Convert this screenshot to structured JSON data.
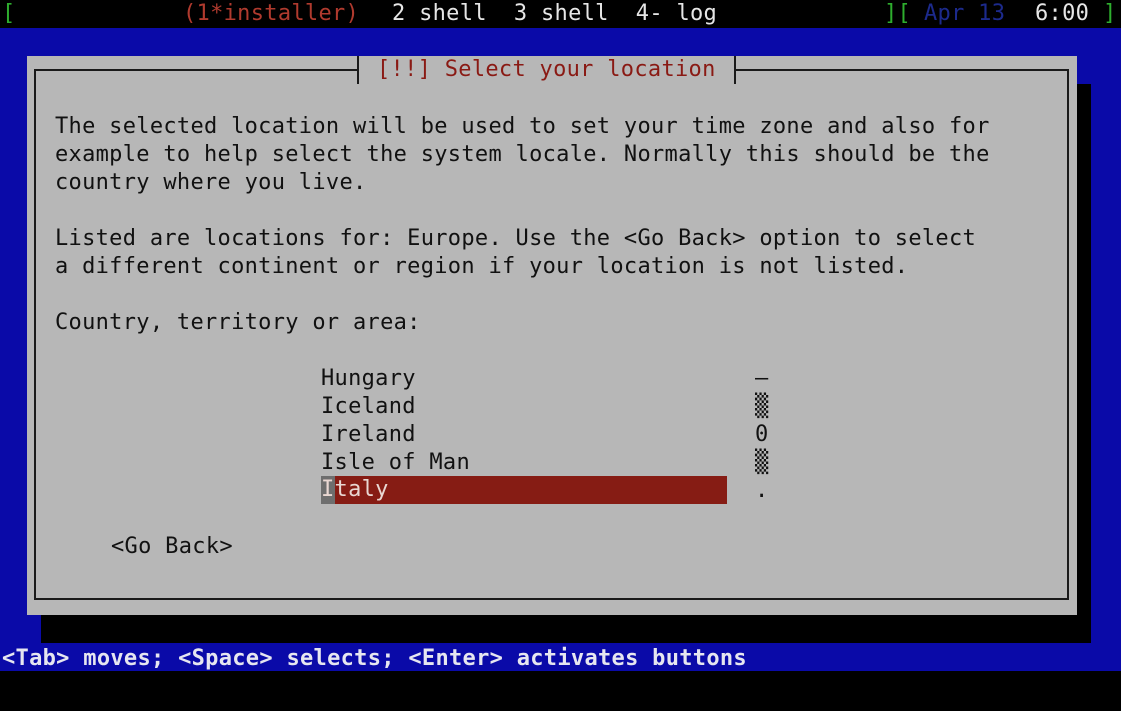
{
  "statusbar": {
    "left_bracket": "[",
    "active_window": "(1*installer)",
    "windows": "2 shell  3 shell  4- log",
    "right_bracket_open": "][",
    "date": "Apr 13",
    "time": "6:00",
    "right_bracket_close": "]"
  },
  "dialog": {
    "title": "[!!] Select your location",
    "paragraph1": [
      "The selected location will be used to set your time zone and also for",
      "example to help select the system locale. Normally this should be the",
      "country where you live."
    ],
    "paragraph2": [
      "Listed are locations for: Europe. Use the <Go Back> option to select",
      "a different continent or region if your location is not listed."
    ],
    "prompt": "Country, territory or area:",
    "list": {
      "items": [
        "Hungary",
        "Iceland",
        "Ireland",
        "Isle of Man",
        "Italy"
      ],
      "selected_index": 4,
      "scrollbar": [
        "–",
        "▒",
        "0",
        "▒",
        "."
      ]
    },
    "go_back": "<Go Back>"
  },
  "help": "<Tab> moves; <Space> selects; <Enter> activates buttons",
  "colors": {
    "screen_blue": "#0a0aa8",
    "dialog_gray": "#b7b7b7",
    "selection_red": "#861c14",
    "title_red": "#8a1a14"
  }
}
